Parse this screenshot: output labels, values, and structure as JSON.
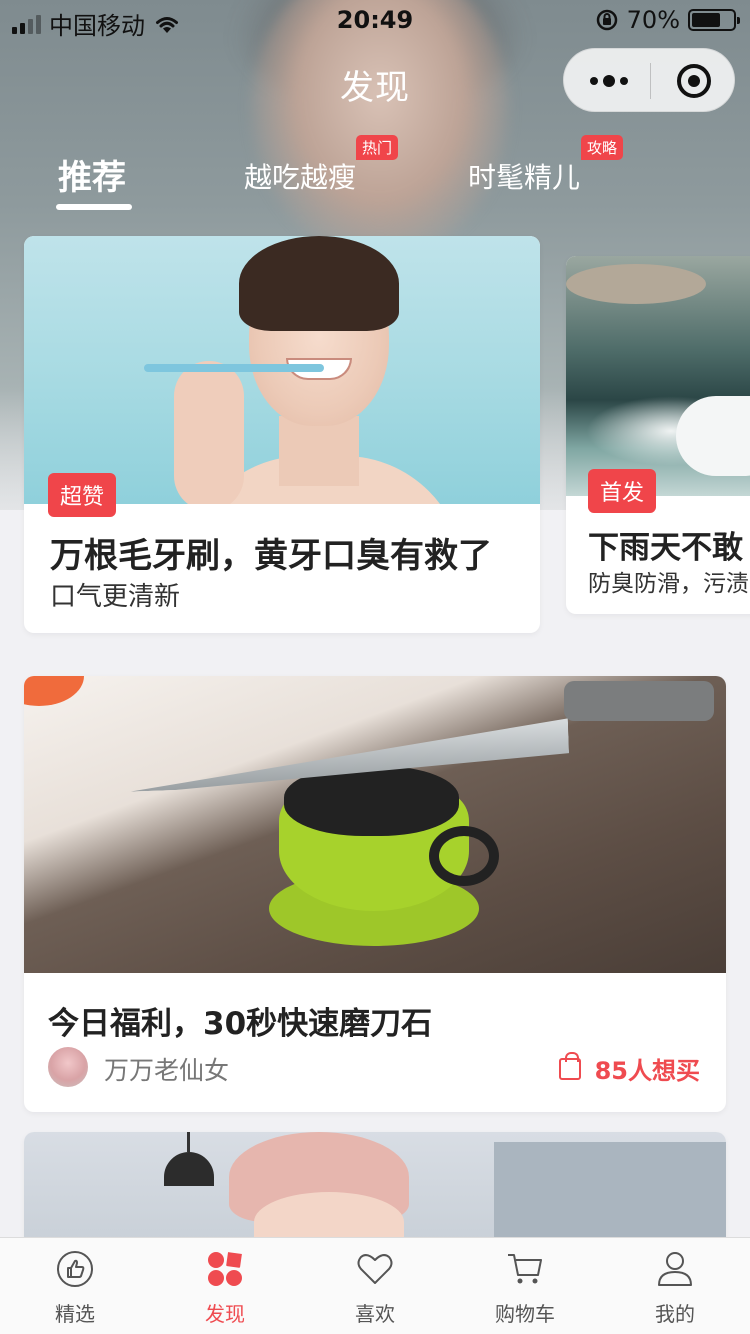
{
  "status_bar": {
    "carrier": "中国移动",
    "time": "20:49",
    "battery_text": "70%",
    "battery_level": 0.7
  },
  "nav": {
    "title": "发现"
  },
  "tabs": [
    {
      "label": "推荐",
      "badge": "",
      "active": true
    },
    {
      "label": "越吃越瘦",
      "badge": "热门",
      "active": false
    },
    {
      "label": "时髦精儿",
      "badge": "攻略",
      "active": false
    }
  ],
  "featured": [
    {
      "tag": "超赞",
      "title": "万根毛牙刷，黄牙口臭有救了",
      "subtitle": "口气更清新"
    },
    {
      "tag": "首发",
      "title": "下雨天不敢",
      "subtitle": "防臭防滑，污渍"
    }
  ],
  "feed": [
    {
      "title": "今日福利，30秒快速磨刀石",
      "author": "万万老仙女",
      "want_count": "85人想买"
    }
  ],
  "tabbar": [
    {
      "label": "精选",
      "icon": "thumbs-up-icon",
      "active": false
    },
    {
      "label": "发现",
      "icon": "discover-icon",
      "active": true
    },
    {
      "label": "喜欢",
      "icon": "heart-icon",
      "active": false
    },
    {
      "label": "购物车",
      "icon": "cart-icon",
      "active": false
    },
    {
      "label": "我的",
      "icon": "user-icon",
      "active": false
    }
  ],
  "colors": {
    "accent": "#ef4b50",
    "tag_red": "#f0454a",
    "page_bg": "#f1f1f4"
  }
}
